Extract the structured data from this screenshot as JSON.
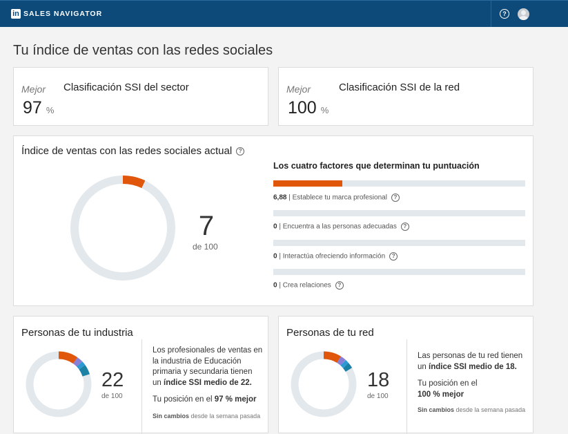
{
  "topbar": {
    "logo_letters": "in",
    "brand": "SALES NAVIGATOR"
  },
  "page_title": "Tu índice de ventas con las redes sociales",
  "sector_card": {
    "best": "Mejor",
    "value": "97",
    "unit": "%",
    "title": "Clasificación SSI del sector"
  },
  "network_card": {
    "best": "Mejor",
    "value": "100",
    "unit": "%",
    "title": "Clasificación SSI de la red"
  },
  "ssi": {
    "title": "Índice de ventas con las redes sociales actual",
    "score": "7",
    "of": "de 100",
    "score_fraction": 0.07,
    "factors_title": "Los cuatro factores que determinan tu puntuación",
    "factors": [
      {
        "value": "6,88",
        "label": "Establece tu marca profesional",
        "fraction": 0.275
      },
      {
        "value": "0",
        "label": "Encuentra a las personas adecuadas",
        "fraction": 0
      },
      {
        "value": "0",
        "label": "Interactúa ofreciendo información",
        "fraction": 0
      },
      {
        "value": "0",
        "label": "Crea relaciones",
        "fraction": 0
      }
    ]
  },
  "industry": {
    "title": "Personas de tu industria",
    "score": "22",
    "of": "de 100",
    "desc_pre": "Los profesionales de ventas en la industria de Educación primaria y secundaria tienen un ",
    "desc_bold": "índice SSI medio de 22.",
    "pos_pre": "Tu posición en el ",
    "pos_bold": "97 % mejor",
    "change_bold": "Sin cambios",
    "change_rest": " desde la semana pasada"
  },
  "network": {
    "title": "Personas de tu red",
    "score": "18",
    "of": "de 100",
    "desc_pre": "Las personas de tu red tienen un ",
    "desc_bold": "índice SSI medio de 18.",
    "pos_pre": "Tu posición en el ",
    "pos_bold": "100 % mejor",
    "change_bold": "Sin cambios",
    "change_rest": " desde la semana pasada"
  },
  "colors": {
    "topbar": "#0d4a7a",
    "orange": "#e0560a",
    "purple": "#8a7fd6",
    "blue": "#2d9ad3",
    "teal": "#1b82a6",
    "track": "#e3e8ec"
  }
}
